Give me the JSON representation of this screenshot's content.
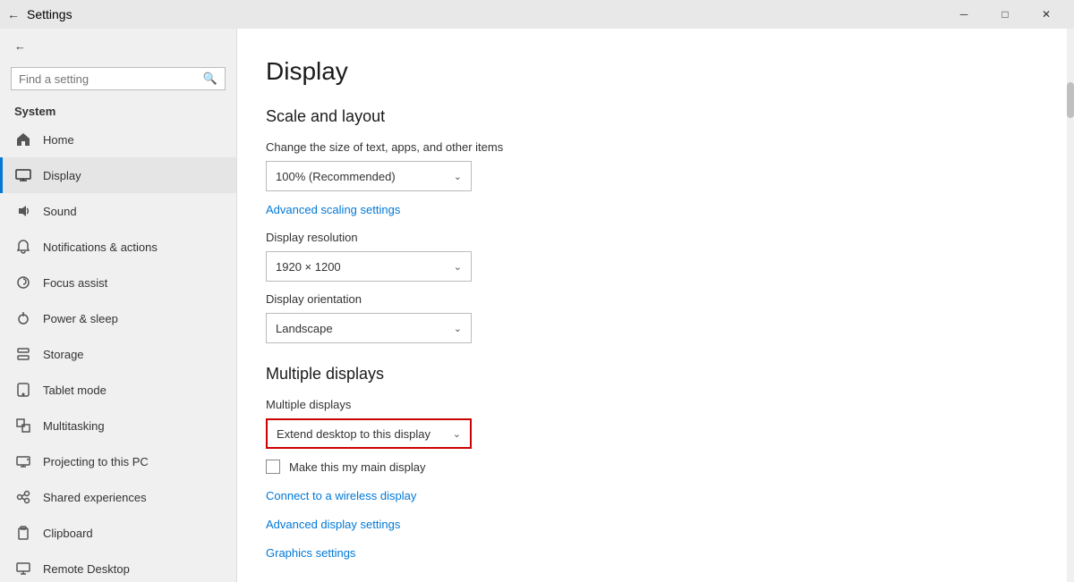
{
  "titleBar": {
    "title": "Settings",
    "backIcon": "←",
    "minimizeIcon": "─",
    "maximizeIcon": "□",
    "closeIcon": "✕"
  },
  "sidebar": {
    "sectionTitle": "System",
    "searchPlaceholder": "Find a setting",
    "items": [
      {
        "id": "home",
        "label": "Home",
        "icon": "⌂"
      },
      {
        "id": "display",
        "label": "Display",
        "icon": "🖥",
        "active": true
      },
      {
        "id": "sound",
        "label": "Sound",
        "icon": "🔊"
      },
      {
        "id": "notifications",
        "label": "Notifications & actions",
        "icon": "🔔"
      },
      {
        "id": "focus",
        "label": "Focus assist",
        "icon": "🌙"
      },
      {
        "id": "power",
        "label": "Power & sleep",
        "icon": "⏻"
      },
      {
        "id": "storage",
        "label": "Storage",
        "icon": "💾"
      },
      {
        "id": "tablet",
        "label": "Tablet mode",
        "icon": "⬜"
      },
      {
        "id": "multitasking",
        "label": "Multitasking",
        "icon": "⧉"
      },
      {
        "id": "projecting",
        "label": "Projecting to this PC",
        "icon": "📽"
      },
      {
        "id": "shared",
        "label": "Shared experiences",
        "icon": "↗"
      },
      {
        "id": "clipboard",
        "label": "Clipboard",
        "icon": "📋"
      },
      {
        "id": "remote",
        "label": "Remote Desktop",
        "icon": "🖥"
      }
    ]
  },
  "main": {
    "pageTitle": "Display",
    "scaleSection": {
      "title": "Scale and layout",
      "scalingLabel": "Change the size of text, apps, and other items",
      "scalingValue": "100% (Recommended)",
      "advancedLink": "Advanced scaling settings",
      "resolutionLabel": "Display resolution",
      "resolutionValue": "1920 × 1200",
      "orientationLabel": "Display orientation",
      "orientationValue": "Landscape"
    },
    "multipleDisplays": {
      "title": "Multiple displays",
      "dropdownLabel": "Multiple displays",
      "dropdownValue": "Extend desktop to this display",
      "checkboxLabel": "Make this my main display",
      "links": [
        "Connect to a wireless display",
        "Advanced display settings",
        "Graphics settings"
      ]
    }
  }
}
